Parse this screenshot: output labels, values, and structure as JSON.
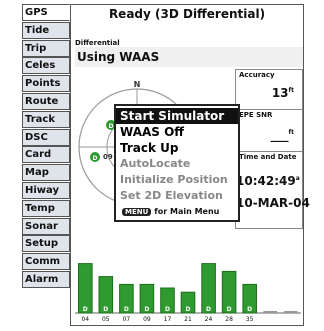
{
  "tabs": [
    {
      "label": "GPS",
      "active": true
    },
    {
      "label": "Tide"
    },
    {
      "label": "Trip"
    },
    {
      "label": "Celes"
    },
    {
      "label": "Points"
    },
    {
      "label": "Route"
    },
    {
      "label": "Track"
    },
    {
      "label": "DSC"
    },
    {
      "label": "Card"
    },
    {
      "label": "Map"
    },
    {
      "label": "Hiway"
    },
    {
      "label": "Temp"
    },
    {
      "label": "Sonar"
    },
    {
      "label": "Setup"
    },
    {
      "label": "Comm"
    },
    {
      "label": "Alarm"
    }
  ],
  "status": {
    "title": "Ready (3D Differential)"
  },
  "differential": {
    "label": "Differential",
    "value": "Using WAAS"
  },
  "sky": {
    "north": "N",
    "sat_labels": [
      "D",
      "D"
    ],
    "sat_numbers": [
      "09"
    ]
  },
  "info": {
    "accuracy_label": "Accuracy",
    "accuracy_value": "13",
    "accuracy_unit": "ft",
    "snr_label": "EPE SNR",
    "snr_value": "___",
    "snr_unit": "ft",
    "date_label": "Time and Date",
    "time_value": "10:42:49",
    "time_suffix": "a",
    "date_value": "10-MAR-04"
  },
  "menu": {
    "items": [
      {
        "label": "Start Simulator",
        "state": "selected"
      },
      {
        "label": "WAAS Off",
        "state": "normal"
      },
      {
        "label": "Track Up",
        "state": "normal"
      },
      {
        "label": "AutoLocate",
        "state": "disabled"
      },
      {
        "label": "Initialize Position",
        "state": "disabled"
      },
      {
        "label": "Set 2D Elevation",
        "state": "disabled"
      }
    ],
    "hint_key": "MENU",
    "hint_text": "for Main Menu"
  },
  "chart_data": {
    "type": "bar",
    "categories": [
      "04",
      "05",
      "07",
      "09",
      "17",
      "21",
      "24",
      "28",
      "35",
      "",
      ""
    ],
    "values": [
      95,
      70,
      55,
      55,
      48,
      40,
      95,
      80,
      55,
      0,
      0
    ],
    "differential_flags": [
      "D",
      "D",
      "D",
      "D",
      "D",
      "D",
      "D",
      "D",
      "D",
      "",
      ""
    ],
    "ylim": [
      0,
      100
    ],
    "grid": false
  }
}
